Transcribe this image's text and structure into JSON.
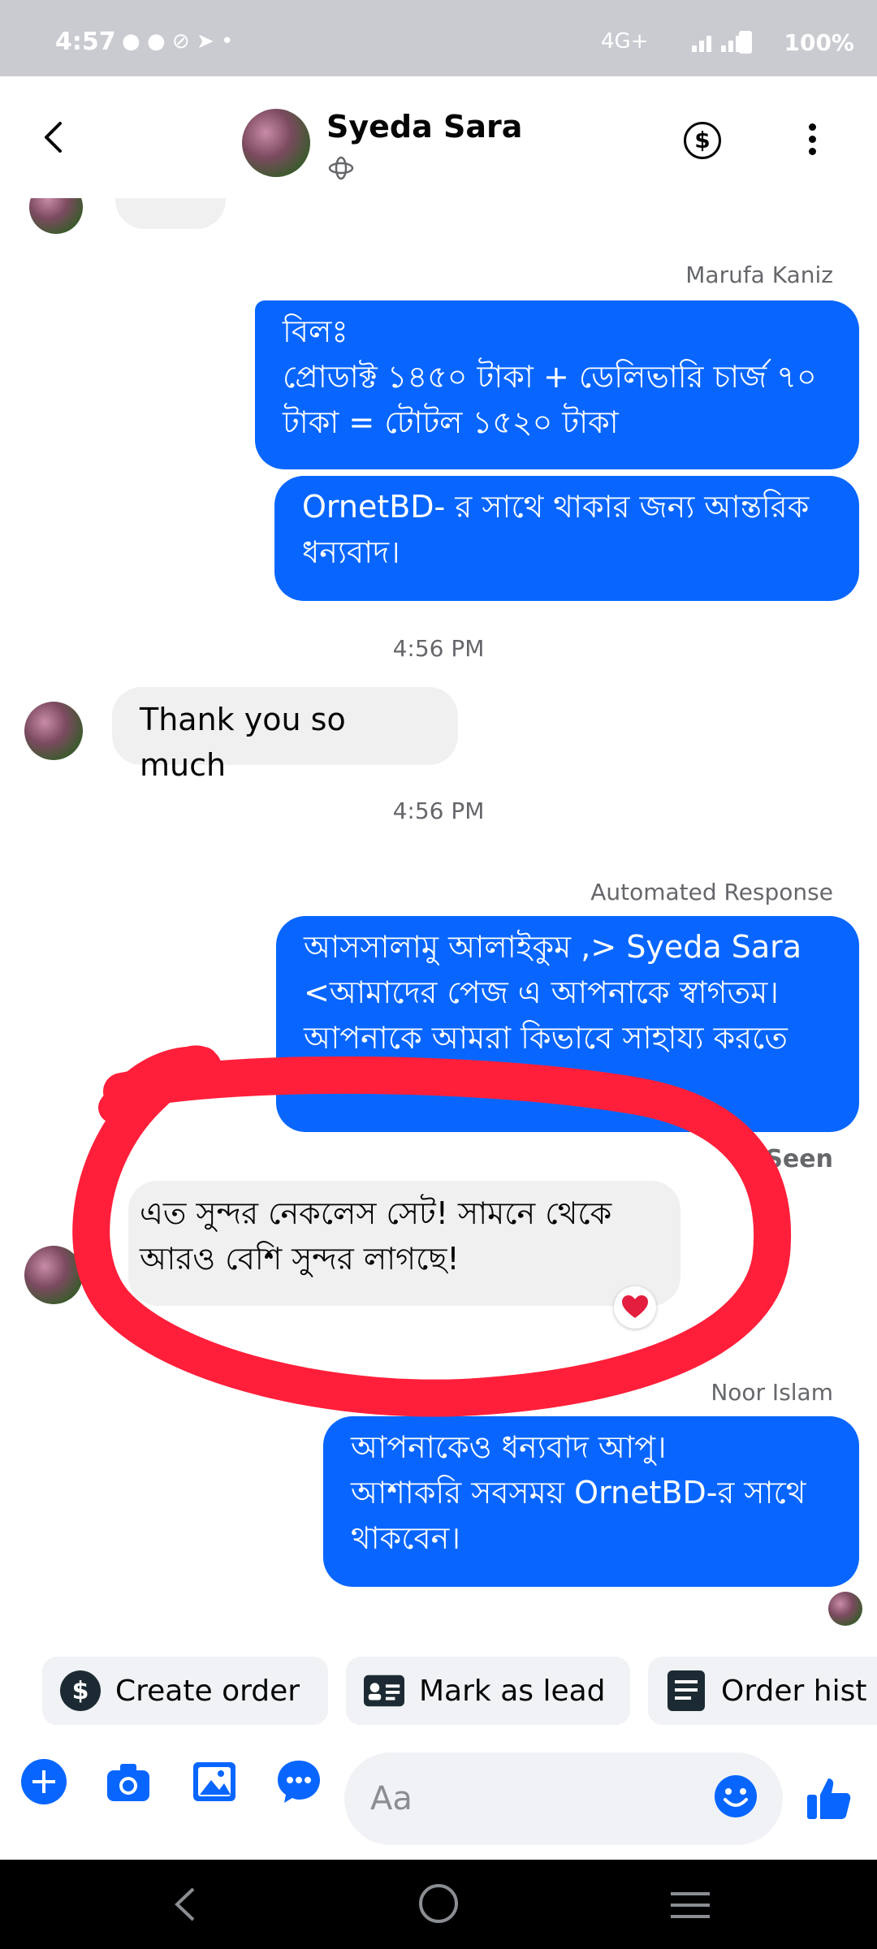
{
  "status_bar": {
    "time": "4:57",
    "indicators": "4G+",
    "battery": "100%"
  },
  "header": {
    "name": "Syeda Sara",
    "subtitle": "",
    "currency_symbol": "$"
  },
  "messages": {
    "sender_1": "Marufa Kaniz",
    "out_1": "বিলঃ\nপ্রোডাক্ট ১৪৫০ টাকা + ডেলিভারি চার্জ ৭০ টাকা = টোটল ১৫২০ টাকা",
    "out_2": "OrnetBD- র সাথে থাকার জন্য আন্তরিক ধন্যবাদ।",
    "ts_1": "4:56 PM",
    "in_1": "Thank you so much",
    "ts_2": "4:56 PM",
    "sender_2": "Automated Response",
    "out_3": "আসসালামু আলাইকুম ,> Syeda Sara <আমাদের পেজ এ  আপনাকে স্বাগতম। আপনাকে আমরা কিভাবে সাহায্য করতে পারি?",
    "seen": "Seen",
    "in_2": "এত সুন্দর নেকলেস সেট! সামনে থেকে আরও বেশি সুন্দর লাগছে!",
    "sender_3": "Noor Islam",
    "out_4": "আপনাকেও ধন্যবাদ আপু।\nআশাকরি সবসময় OrnetBD-র সাথে থাকবেন।"
  },
  "actions": {
    "create_order": "Create order",
    "mark_as_lead": "Mark as lead",
    "order_history": "Order hist"
  },
  "composer": {
    "placeholder": "Aa"
  },
  "colors": {
    "accent": "#0866ff",
    "annotation": "#ff1f3a",
    "reaction": "#e41e3f"
  },
  "icons": [
    "back-icon",
    "dollar-icon",
    "more-icon",
    "add-icon",
    "camera-icon",
    "gallery-icon",
    "chat-more-icon",
    "emoji-icon",
    "like-icon",
    "heart-icon"
  ]
}
